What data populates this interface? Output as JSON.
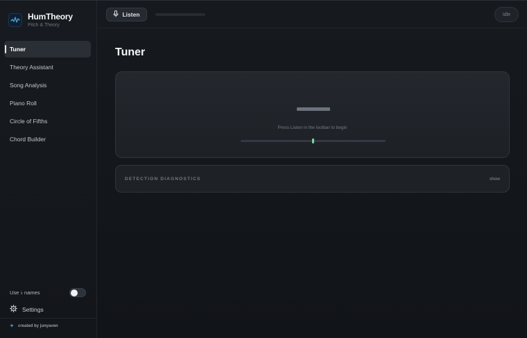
{
  "app": {
    "name": "HumTheory",
    "tagline": "Pitch & Theory"
  },
  "sidebar": {
    "items": [
      {
        "label": "Tuner",
        "active": true
      },
      {
        "label": "Theory Assistant",
        "active": false
      },
      {
        "label": "Song Analysis",
        "active": false
      },
      {
        "label": "Piano Roll",
        "active": false
      },
      {
        "label": "Circle of Fifths",
        "active": false
      },
      {
        "label": "Chord Builder",
        "active": false
      }
    ],
    "toggle_label": "Use ♭ names",
    "toggle_on": false,
    "settings_label": "Settings",
    "credit": "created by junyaven"
  },
  "toolbar": {
    "listen_label": "Listen",
    "status": "Idle",
    "input_level": 0
  },
  "main": {
    "title": "Tuner",
    "hint": "Press Listen in the toolbar to begin",
    "cents_offset": 0,
    "diagnostics_title": "DETECTION DIAGNOSTICS",
    "diagnostics_toggle": "show"
  },
  "colors": {
    "accent_green": "#7dd3a0",
    "logo_blue": "#4aa3e0",
    "background": "#121519"
  },
  "icons": {
    "logo": "waveform-logo-icon",
    "listen": "microphone-icon",
    "settings": "gear-icon",
    "credit": "sparkle-icon"
  }
}
